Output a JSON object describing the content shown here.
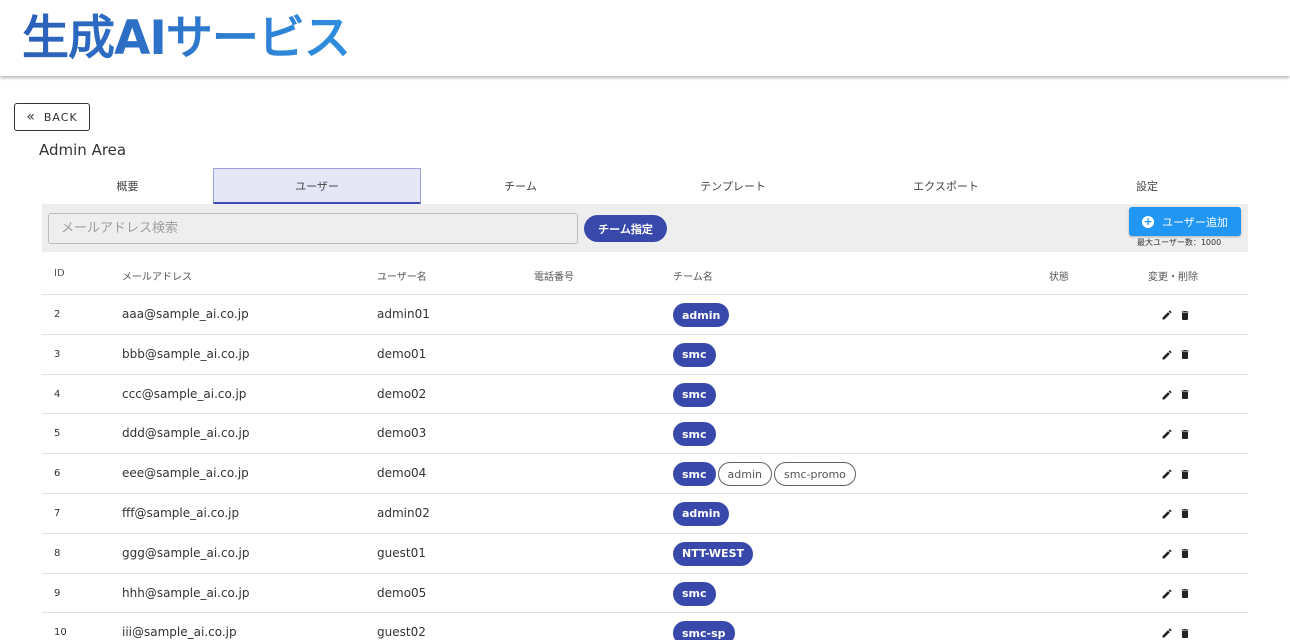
{
  "header": {
    "logo_text": "生成AIサービス"
  },
  "back_label": "BACK",
  "area_title": "Admin Area",
  "tabs": [
    {
      "label": "概要"
    },
    {
      "label": "ユーザー",
      "active": true
    },
    {
      "label": "チーム"
    },
    {
      "label": "テンプレート"
    },
    {
      "label": "エクスポート"
    },
    {
      "label": "設定"
    }
  ],
  "toolbar": {
    "search_placeholder": "メールアドレス検索",
    "team_button": "チーム指定",
    "add_button": "ユーザー追加",
    "max_users": "最大ユーザー数：1000"
  },
  "table": {
    "headers": [
      "ID",
      "メールアドレス",
      "ユーザー名",
      "電話番号",
      "チーム名",
      "状態",
      "変更・削除"
    ],
    "rows": [
      {
        "id": "2",
        "email": "aaa@sample_ai.co.jp",
        "user": "admin01",
        "phone": "",
        "teams": [
          {
            "name": "admin",
            "primary": true
          }
        ],
        "status": ""
      },
      {
        "id": "3",
        "email": "bbb@sample_ai.co.jp",
        "user": "demo01",
        "phone": "",
        "teams": [
          {
            "name": "smc",
            "primary": true
          }
        ],
        "status": ""
      },
      {
        "id": "4",
        "email": "ccc@sample_ai.co.jp",
        "user": "demo02",
        "phone": "",
        "teams": [
          {
            "name": "smc",
            "primary": true
          }
        ],
        "status": ""
      },
      {
        "id": "5",
        "email": "ddd@sample_ai.co.jp",
        "user": "demo03",
        "phone": "",
        "teams": [
          {
            "name": "smc",
            "primary": true
          }
        ],
        "status": ""
      },
      {
        "id": "6",
        "email": "eee@sample_ai.co.jp",
        "user": "demo04",
        "phone": "",
        "teams": [
          {
            "name": "smc",
            "primary": true
          },
          {
            "name": "admin",
            "primary": false
          },
          {
            "name": "smc-promo",
            "primary": false
          }
        ],
        "status": ""
      },
      {
        "id": "7",
        "email": "fff@sample_ai.co.jp",
        "user": "admin02",
        "phone": "",
        "teams": [
          {
            "name": "admin",
            "primary": true
          }
        ],
        "status": ""
      },
      {
        "id": "8",
        "email": "ggg@sample_ai.co.jp",
        "user": "guest01",
        "phone": "",
        "teams": [
          {
            "name": "NTT-WEST",
            "primary": true
          }
        ],
        "status": ""
      },
      {
        "id": "9",
        "email": "hhh@sample_ai.co.jp",
        "user": "demo05",
        "phone": "",
        "teams": [
          {
            "name": "smc",
            "primary": true
          }
        ],
        "status": ""
      },
      {
        "id": "10",
        "email": "iii@sample_ai.co.jp",
        "user": "guest02",
        "phone": "",
        "teams": [
          {
            "name": "smc-sp",
            "primary": true
          }
        ],
        "status": ""
      }
    ]
  },
  "icons": {
    "back": "chevrons-left-icon",
    "add": "plus-circle-icon",
    "edit": "pencil-icon",
    "delete": "trash-icon"
  },
  "colors": {
    "primary": "#3949ab",
    "add_button": "#2196f3",
    "logo": "#2f74d0"
  }
}
